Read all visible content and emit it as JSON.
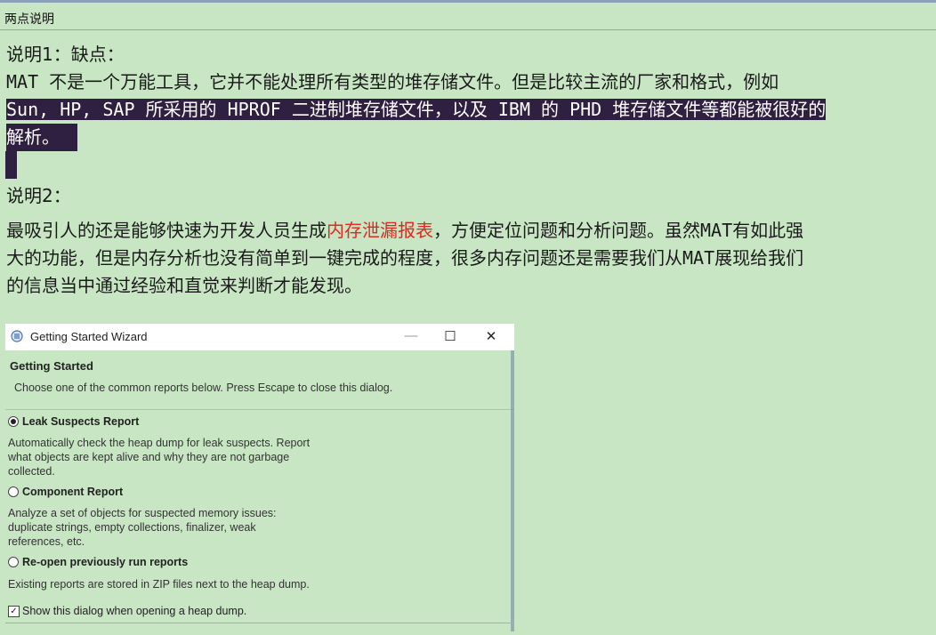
{
  "window": {
    "title": "两点说明"
  },
  "notes": {
    "note1_heading": "说明1：缺点：",
    "note1_line1": "MAT 不是一个万能工具，它并不能处理所有类型的堆存储文件。但是比较主流的厂家和格式，例如",
    "note1_line2": "Sun, HP, SAP 所采用的 HPROF 二进制堆存储文件，以及 IBM 的 PHD 堆存储文件等都能被很好的",
    "note1_line3": "解析。",
    "note2_heading": "说明2：",
    "note2_line1_a": "最吸引人的还是能够快速为开发人员生成",
    "note2_line1_red": "内存泄漏报表",
    "note2_line1_b": "，方便定位问题和分析问题。虽然MAT有如此强",
    "note2_line2": "大的功能，但是内存分析也没有简单到一键完成的程度，很多内存问题还是需要我们从MAT展现给我们",
    "note2_line3": "的信息当中通过经验和直觉来判断才能发现。"
  },
  "wizard": {
    "title": "Getting Started Wizard",
    "heading": "Getting Started",
    "subheading": "Choose one of the common reports below. Press Escape to close this dialog.",
    "options": [
      {
        "label": "Leak Suspects Report",
        "selected": true,
        "desc": [
          "Automatically check the heap dump for leak suspects. Report",
          "what objects are kept alive and why they are not garbage",
          "collected."
        ]
      },
      {
        "label": "Component Report",
        "selected": false,
        "desc": [
          "Analyze a set of objects for suspected memory issues:",
          "duplicate strings, empty collections, finalizer, weak",
          "references, etc."
        ]
      },
      {
        "label": "Re-open previously run reports",
        "selected": false,
        "desc": [
          "Existing reports are stored in ZIP files next to the heap dump."
        ]
      }
    ],
    "checkbox_label": "Show this dialog when opening a heap dump.",
    "checkbox_checked": true,
    "controls": {
      "minimize": "—",
      "maximize": "☐",
      "close": "✕"
    }
  },
  "colors": {
    "background": "#c8e6c4",
    "selection": "#2f1f40",
    "highlight_red": "#e0291f"
  }
}
